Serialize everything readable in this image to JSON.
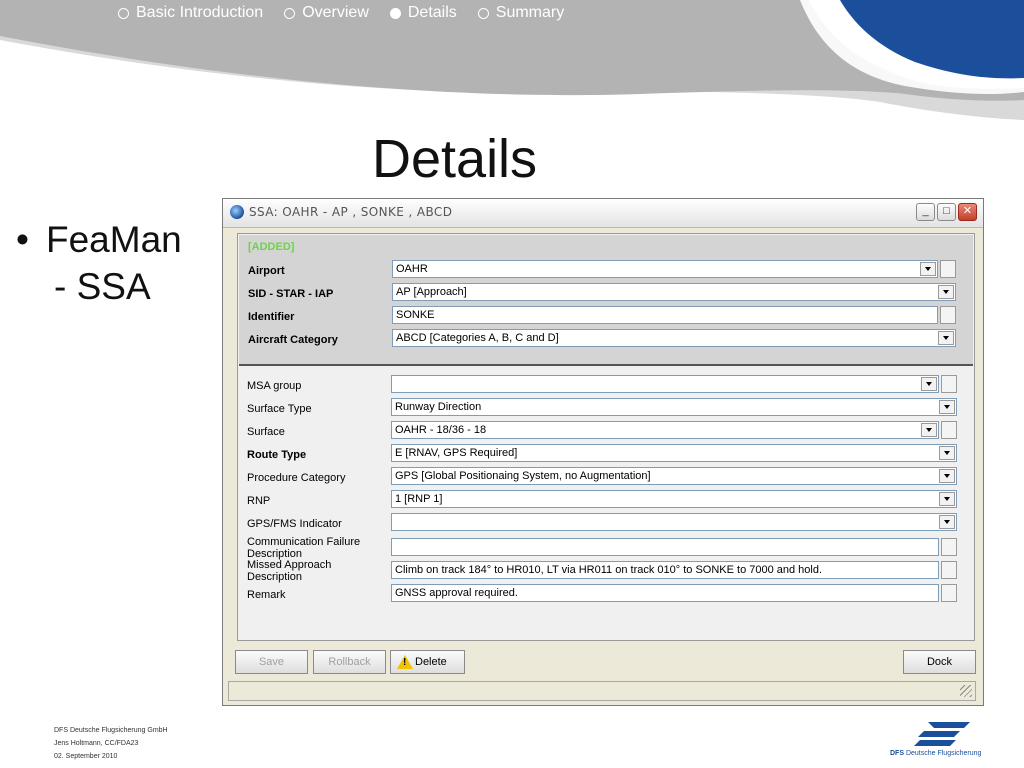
{
  "nav": {
    "items": [
      {
        "label": "Basic Introduction",
        "active": false
      },
      {
        "label": "Overview",
        "active": false
      },
      {
        "label": "Details",
        "active": true
      },
      {
        "label": "Summary",
        "active": false
      }
    ]
  },
  "slide": {
    "title": "Details",
    "bullet_line1": "FeaMan",
    "bullet_line2": "- SSA"
  },
  "window": {
    "title": "SSA: OAHR  -  AP  , SONKE  , ABCD",
    "group_tag": "[ADDED]",
    "top_fields": {
      "airport": {
        "label": "Airport",
        "value": "OAHR"
      },
      "sid_star_iap": {
        "label": "SID - STAR - IAP",
        "value": "AP [Approach]"
      },
      "identifier": {
        "label": "Identifier",
        "value": "SONKE"
      },
      "aircraft_category": {
        "label": "Aircraft Category",
        "value": "ABCD [Categories A, B, C and D]"
      }
    },
    "fields": {
      "msa_group": {
        "label": "MSA group",
        "value": ""
      },
      "surface_type": {
        "label": "Surface Type",
        "value": "Runway Direction"
      },
      "surface": {
        "label": "Surface",
        "value": "OAHR  - 18/36  -  18"
      },
      "route_type": {
        "label": "Route Type",
        "value": "E [RNAV, GPS Required]"
      },
      "procedure_category": {
        "label": "Procedure Category",
        "value": "GPS [Global Positionaing System, no Augmentation]"
      },
      "rnp": {
        "label": "RNP",
        "value": "1 [RNP 1]"
      },
      "gps_fms_indicator": {
        "label": "GPS/FMS Indicator",
        "value": ""
      },
      "comm_failure": {
        "label_line1": "Communication Failure",
        "label_line2": "Description",
        "value": ""
      },
      "missed_approach": {
        "label_line1": "Missed Approach",
        "label_line2": "Description",
        "value": "Climb on track 184° to HR010, LT via HR011 on track 010° to SONKE to 7000 and hold."
      },
      "remark": {
        "label": "Remark",
        "value": "GNSS approval required."
      }
    },
    "buttons": {
      "save": "Save",
      "rollback": "Rollback",
      "delete": "Delete",
      "dock": "Dock"
    }
  },
  "footer": {
    "line1": "DFS Deutsche Flugsicherung GmbH",
    "line2": "Jens Holtmann, CC/FDA23",
    "line3": "02. September 2010",
    "logo_text_bold": "DFS",
    "logo_text": "Deutsche Flugsicherung"
  },
  "colors": {
    "header_gray": "#b3b3b3",
    "header_blue": "#1b4f9c",
    "group_tag": "#6fd24a"
  }
}
